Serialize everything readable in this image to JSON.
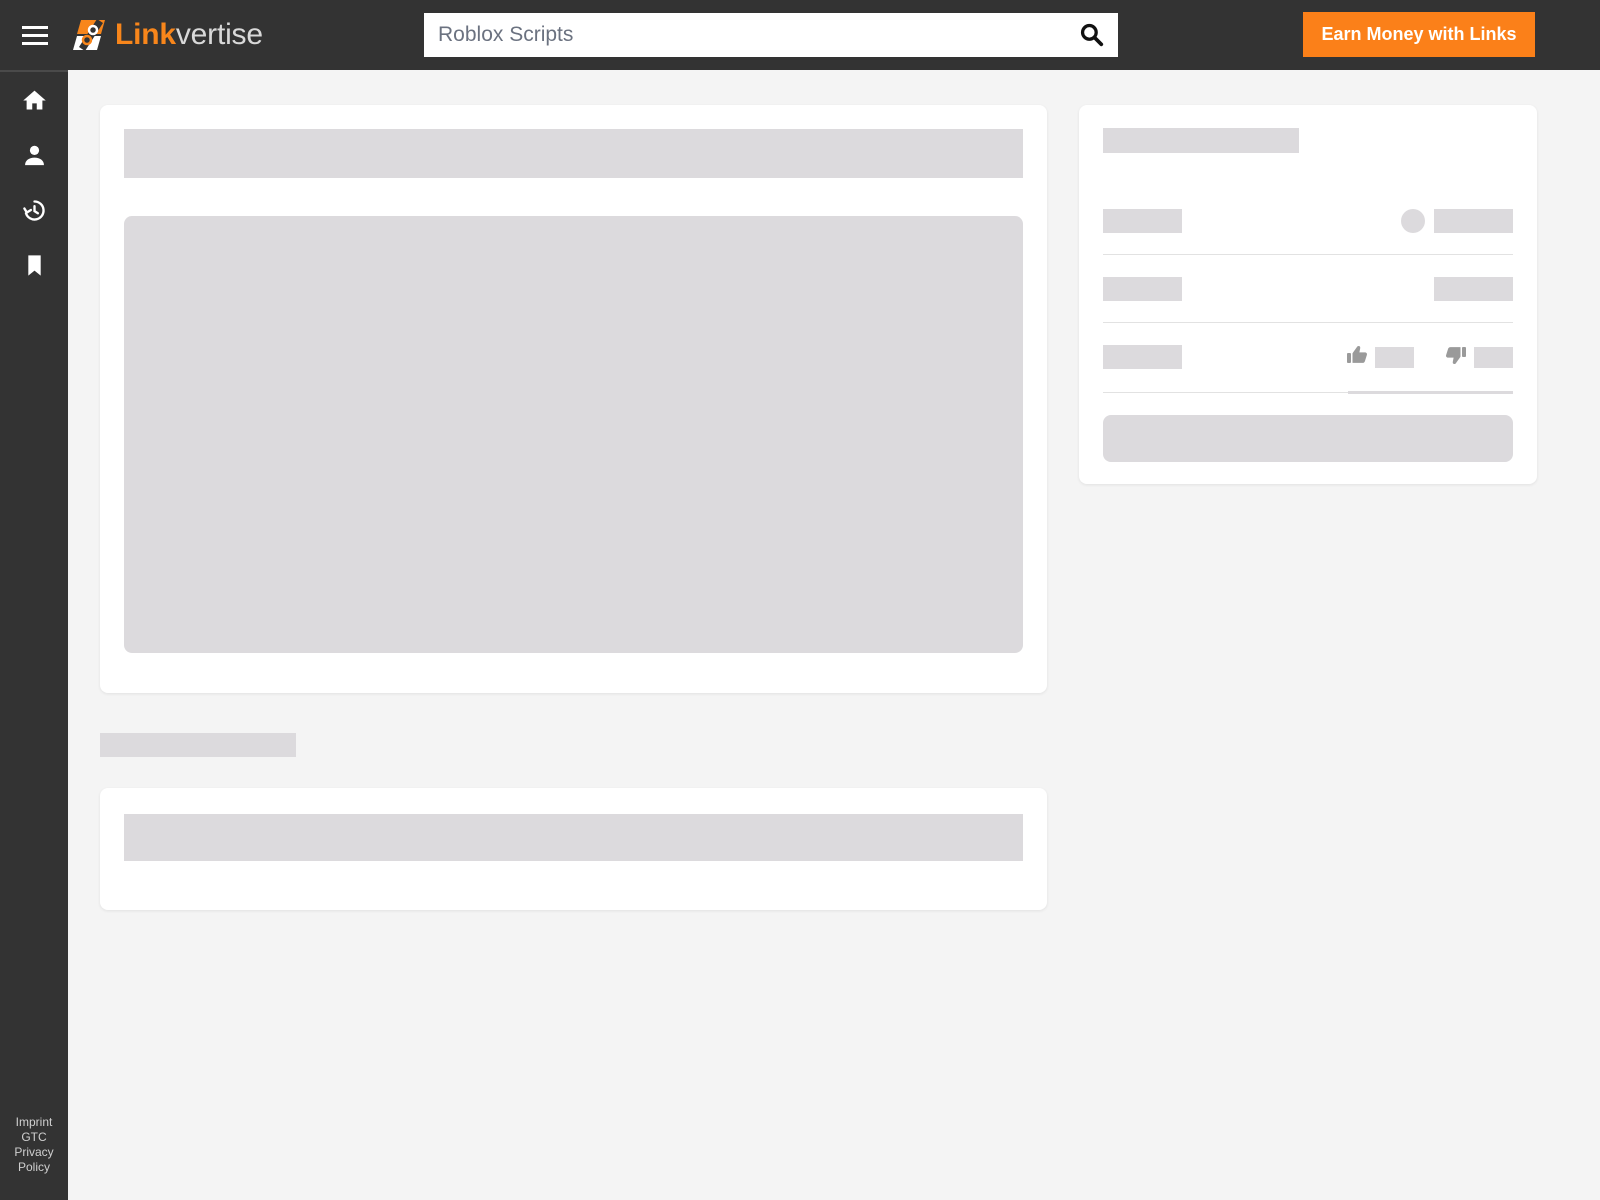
{
  "header": {
    "menu_icon": "hamburger-menu-icon",
    "brand": {
      "logo_icon": "linkvertise-logo-icon",
      "name_primary": "Link",
      "name_secondary": "vertise"
    },
    "search": {
      "value": "Roblox Scripts",
      "placeholder": "Roblox Scripts",
      "icon": "search-icon"
    },
    "earn_button_label": "Earn Money with Links"
  },
  "sidebar": {
    "items": [
      {
        "icon": "home-icon",
        "name": "home"
      },
      {
        "icon": "person-icon",
        "name": "account"
      },
      {
        "icon": "history-icon",
        "name": "history"
      },
      {
        "icon": "bookmark-icon",
        "name": "bookmarks"
      }
    ],
    "footer_links": [
      {
        "label": "Imprint"
      },
      {
        "label": "GTC"
      },
      {
        "label": "Privacy"
      },
      {
        "label": "Policy"
      }
    ]
  },
  "main": {
    "state": "loading-skeleton",
    "primary_card": {
      "title_placeholder": "",
      "hero_placeholder": ""
    },
    "section_label_placeholder": "",
    "secondary_card": {
      "bar_placeholder": ""
    }
  },
  "side_panel": {
    "title_placeholder": "",
    "rows": [
      {
        "label_placeholder": "",
        "avatar_icon": "avatar-circle-icon",
        "value_placeholder": ""
      },
      {
        "label_placeholder": "",
        "value_placeholder": ""
      },
      {
        "label_placeholder": "",
        "like_icon": "thumbs-up-icon",
        "like_count_placeholder": "",
        "dislike_icon": "thumbs-down-icon",
        "dislike_count_placeholder": ""
      }
    ],
    "cta_placeholder": ""
  },
  "colors": {
    "header_bg": "#333333",
    "sidebar_bg": "#333333",
    "accent_orange": "#fb8019",
    "brand_orange": "#f8861b",
    "page_bg": "#f4f4f4",
    "card_bg": "#ffffff",
    "placeholder": "#dcdadd",
    "divider": "#e2e2e2",
    "icon_gray": "#9a9a9a"
  }
}
